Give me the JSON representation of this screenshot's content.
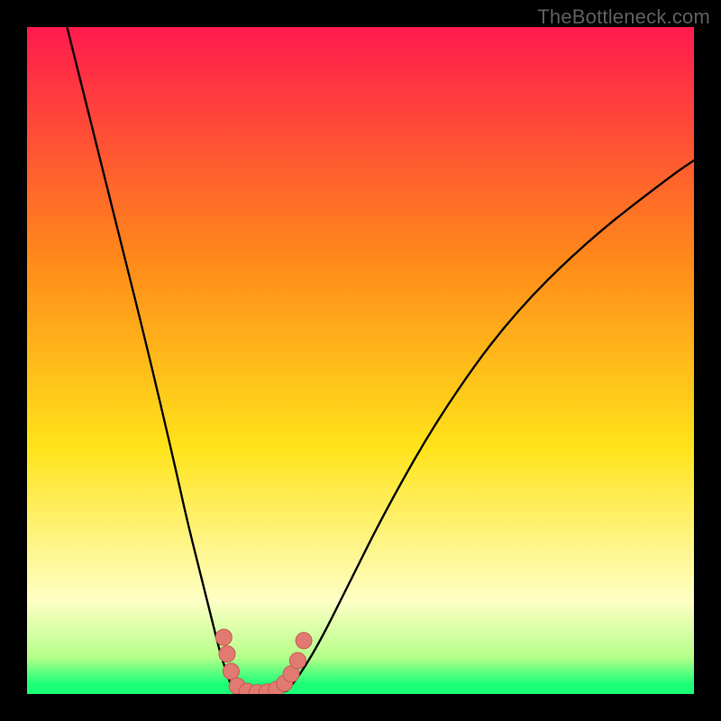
{
  "watermark": "TheBottleneck.com",
  "colors": {
    "black": "#000000",
    "top": "#ff1a4e",
    "orange": "#ff8a1a",
    "yellow": "#ffe31a",
    "pale": "#feffc5",
    "lightgreen": "#b6ff8a",
    "green": "#1bff77",
    "curve": "#000000",
    "dot_fill": "#e17a71",
    "dot_stroke": "#c85a52"
  },
  "chart_data": {
    "type": "line",
    "title": "",
    "xlabel": "",
    "ylabel": "",
    "xlim": [
      0,
      100
    ],
    "ylim": [
      0,
      100
    ],
    "series": [
      {
        "name": "left-branch",
        "x": [
          6,
          10,
          14,
          18,
          22,
          24,
          26,
          28,
          29,
          30,
          30.5,
          31
        ],
        "y": [
          100,
          84,
          68,
          52,
          35,
          26,
          18,
          10,
          6,
          3,
          1.5,
          0.5
        ]
      },
      {
        "name": "floor",
        "x": [
          31,
          33,
          35,
          37,
          39
        ],
        "y": [
          0.5,
          0.0,
          0.0,
          0.0,
          0.5
        ]
      },
      {
        "name": "right-branch",
        "x": [
          39,
          41,
          44,
          48,
          54,
          62,
          72,
          84,
          97,
          100
        ],
        "y": [
          0.5,
          3,
          8,
          16,
          28,
          42,
          56,
          68,
          78,
          80
        ]
      }
    ],
    "dots": {
      "name": "highlight-dots",
      "points": [
        {
          "x": 29.5,
          "y": 8.5
        },
        {
          "x": 30.0,
          "y": 6.0
        },
        {
          "x": 30.6,
          "y": 3.4
        },
        {
          "x": 31.5,
          "y": 1.2
        },
        {
          "x": 33.0,
          "y": 0.4
        },
        {
          "x": 34.5,
          "y": 0.2
        },
        {
          "x": 36.0,
          "y": 0.3
        },
        {
          "x": 37.4,
          "y": 0.7
        },
        {
          "x": 38.6,
          "y": 1.6
        },
        {
          "x": 39.6,
          "y": 3.0
        },
        {
          "x": 40.6,
          "y": 5.0
        },
        {
          "x": 41.5,
          "y": 8.0
        }
      ]
    }
  }
}
